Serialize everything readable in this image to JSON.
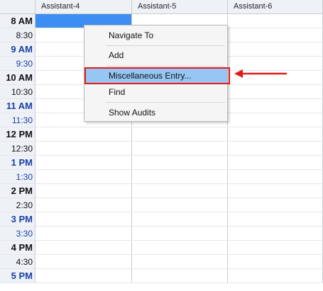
{
  "columns": [
    "Assistant-4",
    "Assistant-5",
    "Assistant-6"
  ],
  "times": [
    {
      "label": "8 AM",
      "hour": true,
      "alt": false
    },
    {
      "label": "8:30",
      "hour": false,
      "alt": false
    },
    {
      "label": "9 AM",
      "hour": true,
      "alt": true
    },
    {
      "label": "9:30",
      "hour": false,
      "alt": true
    },
    {
      "label": "10 AM",
      "hour": true,
      "alt": false
    },
    {
      "label": "10:30",
      "hour": false,
      "alt": false
    },
    {
      "label": "11 AM",
      "hour": true,
      "alt": true
    },
    {
      "label": "11:30",
      "hour": false,
      "alt": true
    },
    {
      "label": "12 PM",
      "hour": true,
      "alt": false
    },
    {
      "label": "12:30",
      "hour": false,
      "alt": false
    },
    {
      "label": "1 PM",
      "hour": true,
      "alt": true
    },
    {
      "label": "1:30",
      "hour": false,
      "alt": true
    },
    {
      "label": "2 PM",
      "hour": true,
      "alt": false
    },
    {
      "label": "2:30",
      "hour": false,
      "alt": false
    },
    {
      "label": "3 PM",
      "hour": true,
      "alt": true
    },
    {
      "label": "3:30",
      "hour": false,
      "alt": true
    },
    {
      "label": "4 PM",
      "hour": true,
      "alt": false
    },
    {
      "label": "4:30",
      "hour": false,
      "alt": false
    },
    {
      "label": "5 PM",
      "hour": true,
      "alt": true
    }
  ],
  "context_menu": {
    "items": [
      {
        "label": "Navigate To"
      },
      {
        "label": "Add"
      },
      {
        "label": "Miscellaneous Entry...",
        "highlighted": true
      },
      {
        "label": "Find"
      },
      {
        "label": "Show Audits"
      }
    ]
  },
  "colors": {
    "selection": "#3d8ef2",
    "menu_highlight": "#95c6f4",
    "annotation": "#e31b1b"
  }
}
